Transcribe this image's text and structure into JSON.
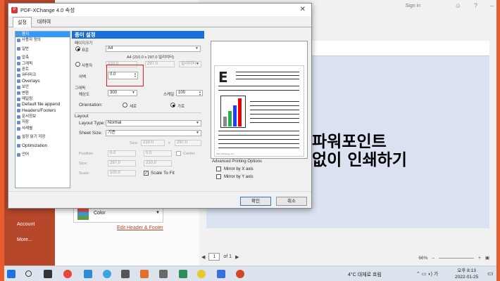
{
  "background": {
    "signin": "Sign in",
    "left_nav": [
      "Account",
      "More..."
    ],
    "color_select": "Color",
    "edit_header_footer": "Edit Header & Footer",
    "slide_line1": "파워포인트",
    "slide_line2": "없이 인쇄하기",
    "pager": {
      "current": "1",
      "of_label": "of 1"
    },
    "zoom": "66%"
  },
  "taskbar": {
    "weather": "4°C  대체로 흐림",
    "time": "오후 8:13",
    "date": "2022-01-25"
  },
  "dialog": {
    "title": "PDF-XChange 4.0 속성",
    "tabs": [
      "설정",
      "대하여"
    ],
    "tree": [
      {
        "label": "용지",
        "selected": true
      },
      {
        "label": "사용자 정의"
      },
      {
        "label": "일반"
      },
      {
        "label": "압축"
      },
      {
        "label": "그래픽"
      },
      {
        "label": "폰트"
      },
      {
        "label": "워터마크"
      },
      {
        "label": "Overlays",
        "big": true
      },
      {
        "label": "보안"
      },
      {
        "label": "변환"
      },
      {
        "label": "메일링"
      },
      {
        "label": "Default file append",
        "big": true
      },
      {
        "label": "Headers/Footers",
        "big": true
      },
      {
        "label": "문서정보"
      },
      {
        "label": "저장"
      },
      {
        "label": "사례별"
      },
      {
        "label": "설정 읽기 저장"
      },
      {
        "label": "Optimization",
        "big": true
      },
      {
        "label": "언어"
      }
    ],
    "panel_title": "종이 설정",
    "paper_size_label": "페이지크기",
    "standard_label": "표준",
    "standard_value": "A4",
    "standard_desc": "A4 (210.0 x 297.0 밀리미터)",
    "custom_label": "사용자",
    "custom_width": "210.0",
    "custom_height": "297.0",
    "custom_unit": "밀리미터",
    "margin_label": "여백",
    "margin_value": "0.0",
    "graphics_label": "그래픽",
    "resolution_label": "해상도",
    "resolution_value": "300",
    "scale_label": "스케일",
    "scale_value": "100",
    "orientation_label": "Orientation:",
    "portrait_label": "세로",
    "landscape_label": "가로",
    "layout_label": "Layout",
    "layout_type_label": "Layout Type:",
    "layout_type_value": "Normal",
    "sheet_size_label": "Sheet Size:",
    "sheet_size_value": "기준",
    "size_label": "Size:",
    "size_w": "210.0",
    "size_x": "x",
    "size_h": "297.0",
    "position_label": "Position:",
    "position_x": "0.0",
    "position_y": "0.0",
    "center_label": "Center",
    "size2_label": "Size:",
    "size2_w": "297.0",
    "size2_h": "210.0",
    "scale2_label": "Scale:",
    "scale2_value": "100.0",
    "scale_to_fit_label": "Scale To Fit",
    "preview_footer": "PDF-XChange 4.0",
    "advanced_title": "Advanced Printing Options",
    "mirror_x": "Mirror by X axis",
    "mirror_y": "Mirror by Y axis",
    "ok": "확인",
    "cancel": "취소"
  },
  "colors": {
    "accent": "#1a6fd6",
    "highlight": "#e02020",
    "ppt": "#b7472a",
    "frame": "#e85d2e"
  }
}
